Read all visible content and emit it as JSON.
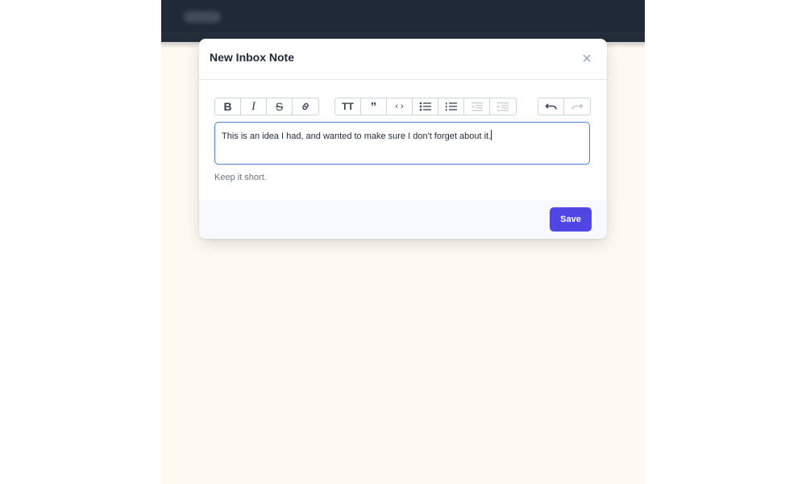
{
  "modal": {
    "title": "New Inbox Note",
    "close_icon": "close-icon",
    "editor_text": "This is an idea I had, and wanted to make sure I don't forget about it.",
    "hint": "Keep it short.",
    "save_label": "Save"
  },
  "toolbar": {
    "groups": [
      [
        "bold-icon",
        "italic-icon",
        "strikethrough-icon",
        "link-icon"
      ],
      [
        "heading-icon",
        "quote-icon",
        "code-icon",
        "bullet-list-icon",
        "numbered-list-icon",
        "outdent-icon",
        "indent-icon"
      ],
      [
        "undo-icon",
        "redo-icon"
      ]
    ],
    "disabled": [
      "outdent-icon",
      "indent-icon",
      "redo-icon"
    ]
  },
  "colors": {
    "accent": "#4f46e5",
    "topbar": "#1f2937",
    "editor_focus_border": "#4f7fd6",
    "background": "#fef9f1"
  }
}
